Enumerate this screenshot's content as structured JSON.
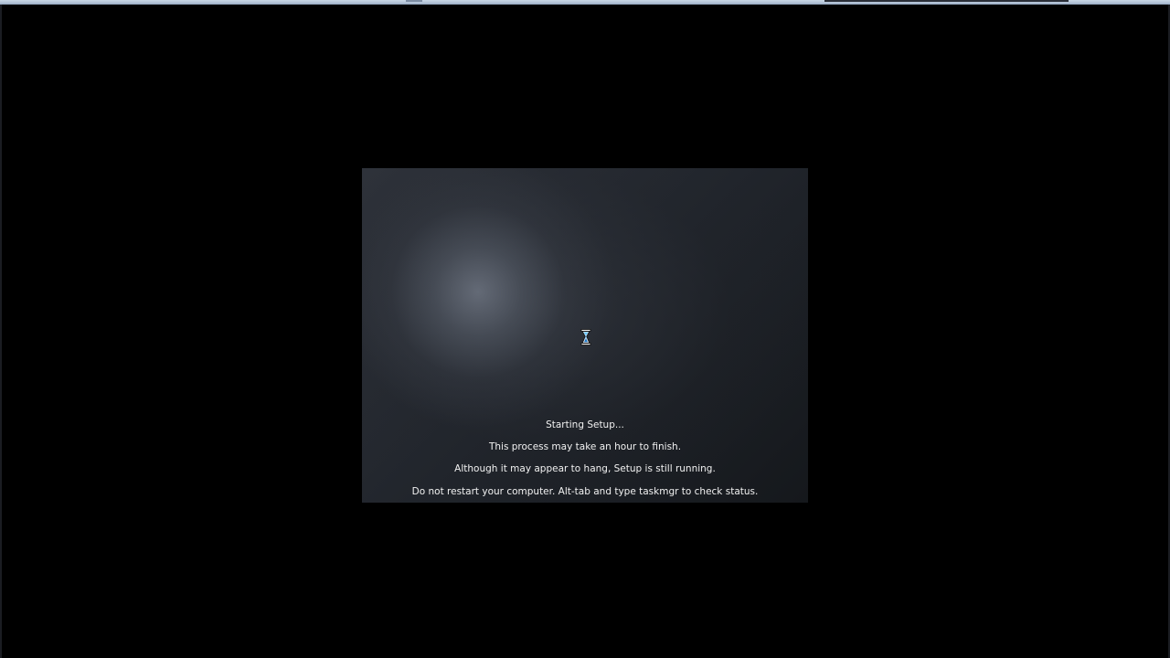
{
  "window": {
    "background": "#000000",
    "chrome_color": "#aebfd3"
  },
  "setup": {
    "cursor_icon": "hourglass-icon",
    "messages": [
      "Starting Setup...",
      "This process may take an hour to finish.",
      "Although it may appear to hang, Setup is still running.",
      "Do not restart your computer.  Alt-tab and type taskmgr to check status."
    ]
  }
}
